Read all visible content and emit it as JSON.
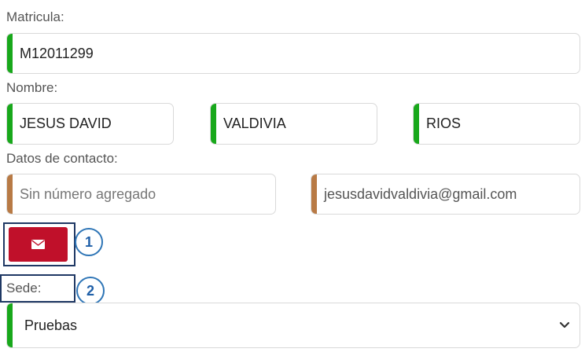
{
  "matricula": {
    "label": "Matricula:",
    "value": "M12011299"
  },
  "nombre": {
    "label": "Nombre:",
    "first_name": "JESUS DAVID",
    "last_name_1": "VALDIVIA",
    "last_name_2": "RIOS"
  },
  "contacto": {
    "label": "Datos de contacto:",
    "phone_placeholder": "Sin número agregado",
    "email": "jesusdavidvaldivia@gmail.com"
  },
  "email_button": {
    "icon": "envelope-icon"
  },
  "sede": {
    "label": "Sede:",
    "selected": "Pruebas"
  },
  "callouts": [
    "1",
    "2"
  ],
  "colors": {
    "accent_green": "#18a81b",
    "accent_brown": "#b87a45",
    "button_red": "#c0102a",
    "callout_border": "#2e75b6",
    "highlight_border": "#1f3864"
  }
}
